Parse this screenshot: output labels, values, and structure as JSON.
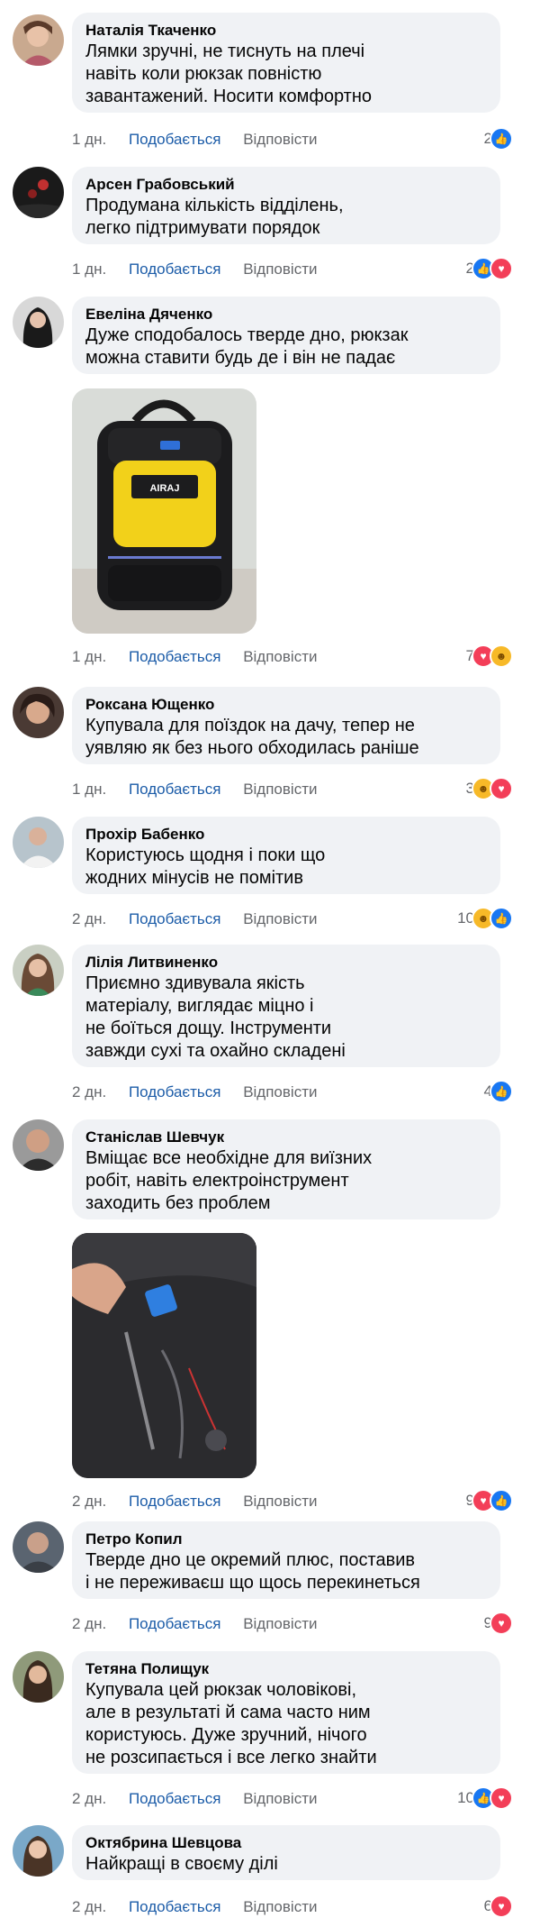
{
  "comments": [
    {
      "author": "Наталія Ткаченко",
      "lines": [
        "Лямки зручні, не тиснуть на плечі",
        "навіть коли рюкзак повністю",
        "завантажений. Носити комфортно"
      ],
      "time": "1 дн.",
      "like": "Подобається",
      "reply": "Відповісти",
      "count": "2",
      "reactions": [
        "like"
      ]
    },
    {
      "author": "Арсен Грабовський",
      "lines": [
        "Продумана кількість відділень,",
        "легко підтримувати порядок"
      ],
      "time": "1 дн.",
      "like": "Подобається",
      "reply": "Відповісти",
      "count": "2",
      "reactions": [
        "like",
        "love"
      ]
    },
    {
      "author": "Евеліна Дяченко",
      "lines": [
        "Дуже сподобалось тверде дно, рюкзак",
        "можна ставити будь де і він не падає"
      ],
      "time": "1 дн.",
      "like": "Подобається",
      "reply": "Відповісти",
      "count": "7",
      "reactions": [
        "love",
        "care"
      ],
      "photo_label": "AIRAJ"
    },
    {
      "author": "Роксана Ющенко",
      "lines": [
        "Купувала для поїздок на дачу, тепер не",
        "уявляю як без нього обходилась раніше"
      ],
      "time": "1 дн.",
      "like": "Подобається",
      "reply": "Відповісти",
      "count": "3",
      "reactions": [
        "care",
        "love"
      ]
    },
    {
      "author": "Прохір Бабенко",
      "lines": [
        "Користуюсь щодня і поки що",
        "жодних мінусів не помітив"
      ],
      "time": "2 дн.",
      "like": "Подобається",
      "reply": "Відповісти",
      "count": "10",
      "reactions": [
        "care",
        "like"
      ]
    },
    {
      "author": "Лілія Литвиненко",
      "lines": [
        "Приємно здивувала якість",
        "матеріалу, виглядає міцно і",
        "не боїться дощу. Інструменти",
        "завжди сухі та охайно складені"
      ],
      "time": "2 дн.",
      "like": "Подобається",
      "reply": "Відповісти",
      "count": "4",
      "reactions": [
        "like"
      ]
    },
    {
      "author": "Станіслав Шевчук",
      "lines": [
        "Вміщає все необхідне для виїзних",
        "робіт, навіть електроінструмент",
        "заходить без проблем"
      ],
      "time": "2 дн.",
      "like": "Подобається",
      "reply": "Відповісти",
      "count": "9",
      "reactions": [
        "love",
        "like"
      ]
    },
    {
      "author": "Петро Копил",
      "lines": [
        "Тверде дно це окремий плюс, поставив",
        "і не переживаєш що щось перекинеться"
      ],
      "time": "2 дн.",
      "like": "Подобається",
      "reply": "Відповісти",
      "count": "9",
      "reactions": [
        "love"
      ]
    },
    {
      "author": "Тетяна Полищук",
      "lines": [
        "Купувала цей рюкзак чоловікові,",
        "але в результаті й сама часто ним",
        "користуюсь. Дуже зручний, нічого",
        "не розсипається і все легко знайти"
      ],
      "time": "2 дн.",
      "like": "Подобається",
      "reply": "Відповісти",
      "count": "10",
      "reactions": [
        "like",
        "love"
      ]
    },
    {
      "author": "Октябрина Шевцова",
      "lines": [
        "Найкращі в своєму ділі"
      ],
      "time": "2 дн.",
      "like": "Подобається",
      "reply": "Відповісти",
      "count": "6",
      "reactions": [
        "love"
      ]
    }
  ],
  "colors": {
    "bubble": "#f0f2f5",
    "link": "#1c5ca8",
    "meta": "#65676b",
    "like": "#1877f2",
    "love": "#f33e58"
  }
}
